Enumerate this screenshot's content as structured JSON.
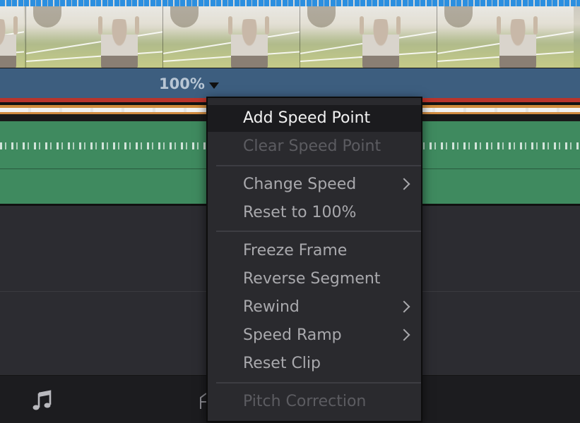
{
  "timeline": {
    "speed_value": "100%",
    "speed_dropdown_icon": "caret-down-icon",
    "frames_count_visible": 5
  },
  "toolbar": {
    "music_icon": "music-note-icon",
    "partial_icon": "partial-icon"
  },
  "context_menu": {
    "items": [
      {
        "label": "Add Speed Point",
        "state": "highlighted",
        "submenu": false
      },
      {
        "label": "Clear Speed Point",
        "state": "disabled",
        "submenu": false
      },
      {
        "label": "Change Speed",
        "state": "enabled",
        "submenu": true
      },
      {
        "label": "Reset to 100%",
        "state": "enabled",
        "submenu": false
      },
      {
        "label": "Freeze Frame",
        "state": "enabled",
        "submenu": false
      },
      {
        "label": "Reverse Segment",
        "state": "enabled",
        "submenu": false
      },
      {
        "label": "Rewind",
        "state": "enabled",
        "submenu": true
      },
      {
        "label": "Speed Ramp",
        "state": "enabled",
        "submenu": true
      },
      {
        "label": "Reset Clip",
        "state": "enabled",
        "submenu": false
      },
      {
        "label": "Pitch Correction",
        "state": "disabled",
        "submenu": false
      }
    ]
  },
  "colors": {
    "speed_bar": "#3d5e7f",
    "audio_clip": "#3f8a5f",
    "speed_marker": "#2b8fe0",
    "menu_bg": "#2a2a2e",
    "menu_highlight": "#1b1b1e"
  }
}
